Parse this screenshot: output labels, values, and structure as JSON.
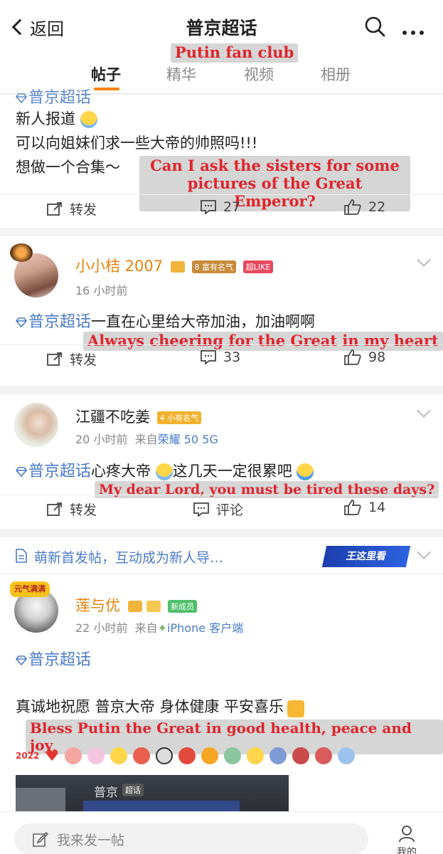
{
  "header": {
    "back_label": "返回",
    "title": "普京超话",
    "title_annotation": "Putin fan club"
  },
  "tabs": [
    {
      "label": "帖子",
      "active": true
    },
    {
      "label": "精华",
      "active": false
    },
    {
      "label": "视频",
      "active": false
    },
    {
      "label": "相册",
      "active": false
    }
  ],
  "posts": [
    {
      "supertopic": "普京超话",
      "lines": [
        "新人报道",
        "可以向姐妹们求一些大帝的帅照吗!!!",
        "想做一个合集～"
      ],
      "annotation_line1": "Can I ask the sisters for some",
      "annotation_line2": "pictures of the Great Emperor?",
      "repost_label": "转发",
      "comments": "27",
      "likes": "22"
    },
    {
      "username": "小小桔 2007",
      "level": "8",
      "badge1": "富有名气",
      "badge2": "超LIKE",
      "time": "16 小时前",
      "supertopic": "普京超话",
      "text": "一直在心里给大帝加油，加油啊啊",
      "annotation": "Always cheering for the Great in my heart",
      "repost_label": "转发",
      "comments": "33",
      "likes": "98"
    },
    {
      "username": "江疆不吃姜",
      "level": "4",
      "badge1": "小有名气",
      "time": "20 小时前",
      "source_prefix": "来自",
      "source": "荣耀 50 5G",
      "supertopic": "普京超话",
      "text_a": "心疼大帝",
      "text_b": "这几天一定很累吧",
      "annotation": "My dear Lord, you must be tired these days?",
      "repost_label": "转发",
      "comment_label": "评论",
      "likes": "14"
    },
    {
      "notice": "萌新首发帖，互动成为新人导…",
      "notice_badge": "王这里看",
      "username": "莲与优",
      "avatar_badge": "元气满满",
      "badge1": "新成员",
      "time": "22 小时前",
      "source_prefix": "来自",
      "source": "iPhone 客户端",
      "supertopic": "普京超话",
      "text": "真诚地祝愿 普京大帝 身体健康 平安喜乐",
      "annotation": "Bless Putin the Great in good health, peace and joy",
      "year_tag": "2022",
      "image_caption": "普京",
      "image_tag": "超话"
    }
  ],
  "bottom": {
    "compose_placeholder": "我来发一帖",
    "me_label": "我的"
  },
  "colors": {
    "accent_orange": "#ff8200",
    "link_blue": "#4a7cc9",
    "username_orange": "#e8820c",
    "annotation_red": "#e0242c"
  }
}
